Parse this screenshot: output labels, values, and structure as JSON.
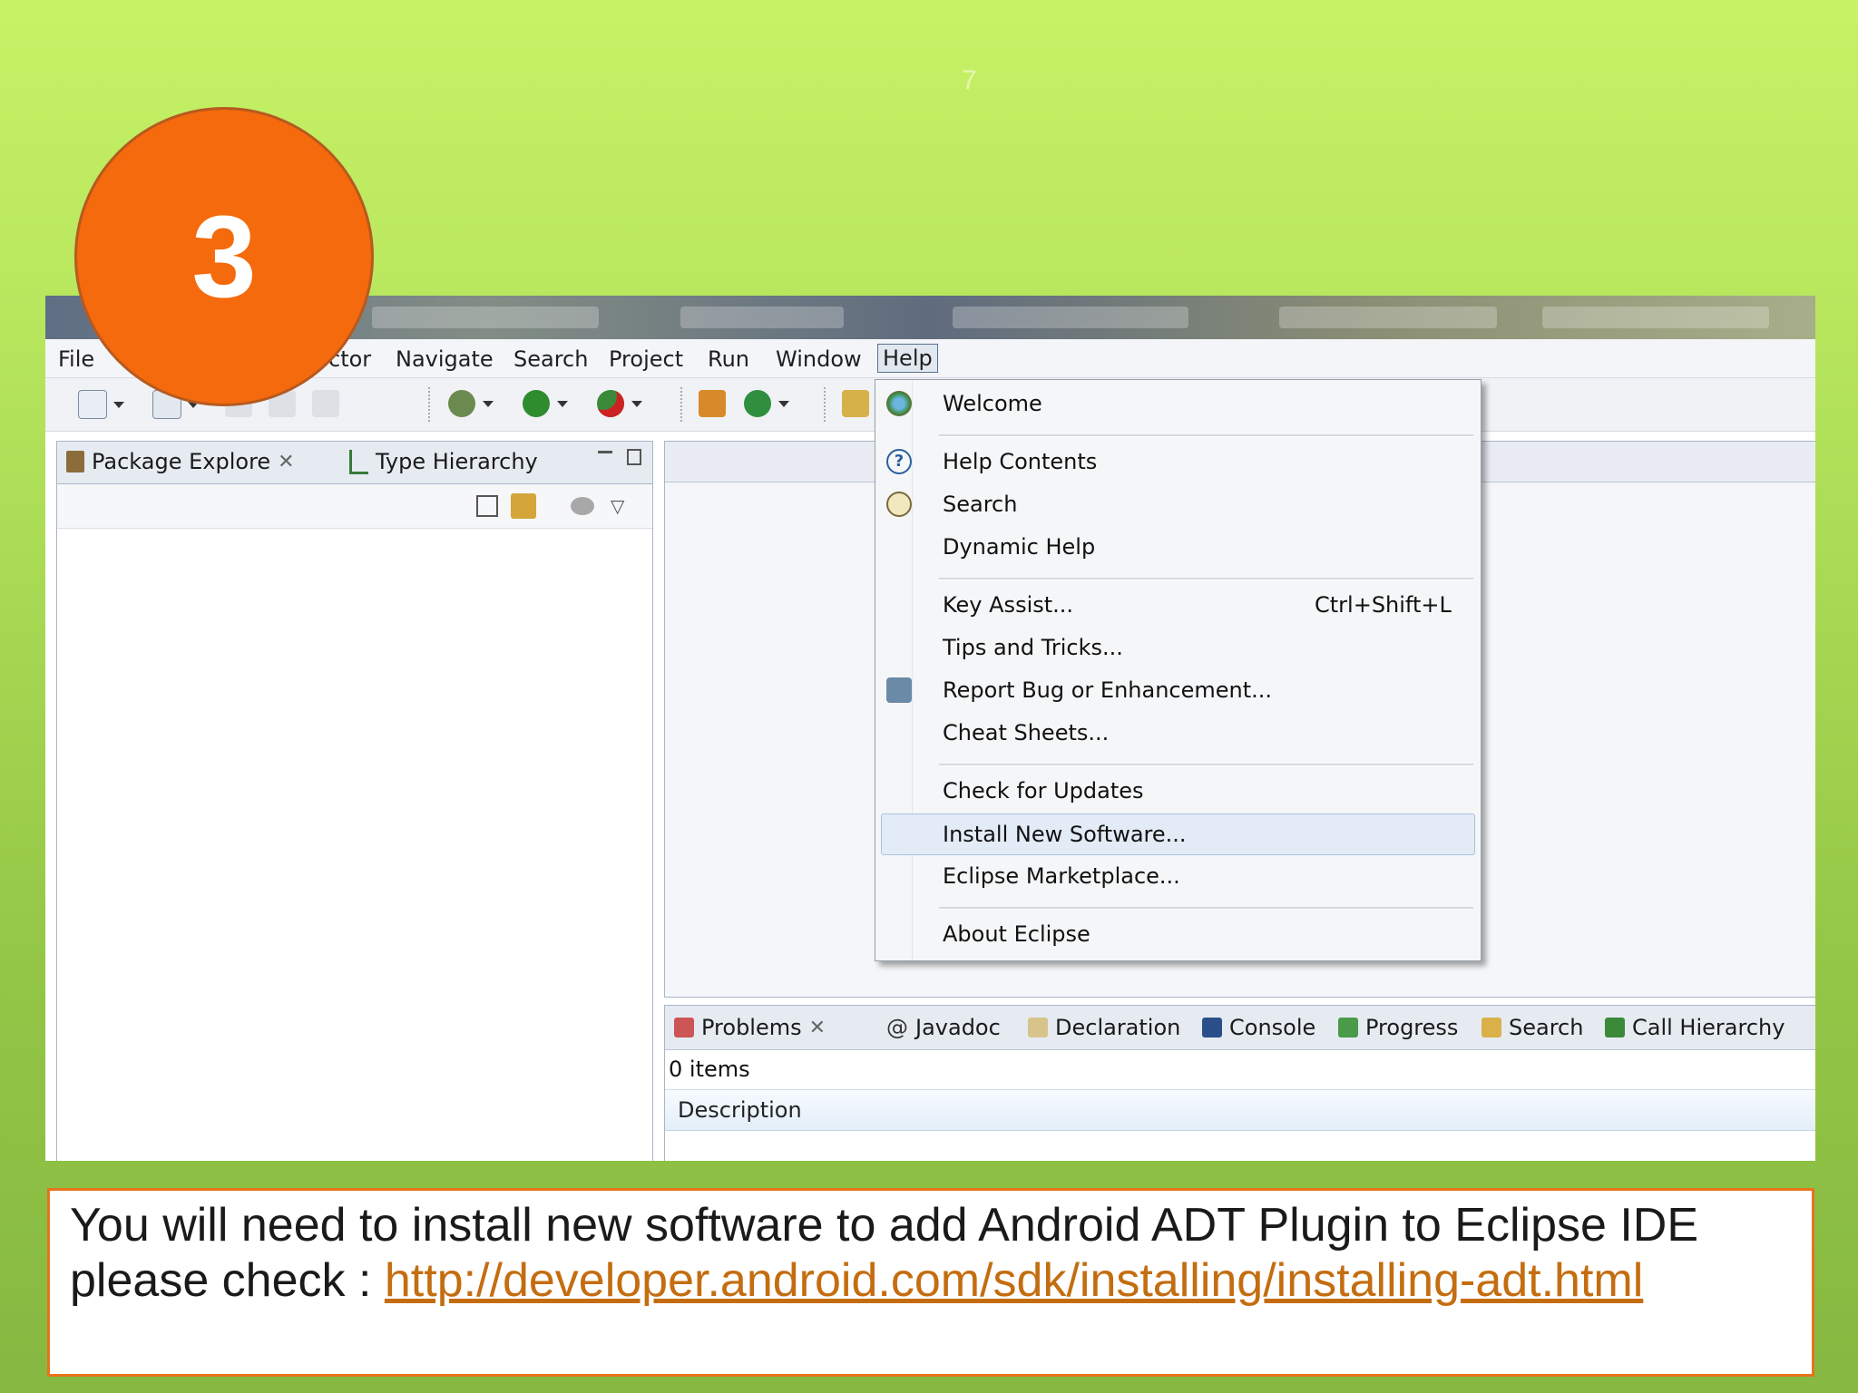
{
  "slide": {
    "number": "7",
    "step_badge": "3"
  },
  "menubar": {
    "items": [
      "File",
      "",
      "ctor",
      "Navigate",
      "Search",
      "Project",
      "Run",
      "Window",
      "Help"
    ]
  },
  "package_explorer": {
    "tabs": [
      {
        "label": "Package Explore",
        "icon": "package-icon"
      },
      {
        "label": "Type Hierarchy",
        "icon": "hierarchy-icon"
      }
    ]
  },
  "help_menu": {
    "items": [
      {
        "label": "Welcome",
        "icon": "welcome-icon"
      },
      {
        "label": "Help Contents",
        "icon": "help-icon"
      },
      {
        "label": "Search",
        "icon": "search-icon"
      },
      {
        "label": "Dynamic Help"
      },
      {
        "label": "Key Assist...",
        "shortcut": "Ctrl+Shift+L"
      },
      {
        "label": "Tips and Tricks..."
      },
      {
        "label": "Report Bug or Enhancement...",
        "icon": "bug-icon"
      },
      {
        "label": "Cheat Sheets..."
      },
      {
        "label": "Check for Updates"
      },
      {
        "label": "Install New Software...",
        "highlighted": true
      },
      {
        "label": "Eclipse Marketplace..."
      },
      {
        "label": "About Eclipse"
      }
    ]
  },
  "bottom_panel": {
    "tabs": [
      "Problems",
      "Javadoc",
      "Declaration",
      "Console",
      "Progress",
      "Search",
      "Call Hierarchy"
    ],
    "items_count": "0 items",
    "column_header": "Description"
  },
  "caption": {
    "text": "You will need to install new software to add Android ADT Plugin to Eclipse IDE please check : ",
    "link": "http://developer.android.com/sdk/installing/installing-adt.html"
  },
  "colors": {
    "badge": "#f56a0c",
    "caption_border": "#e8731b",
    "link": "#c46d10",
    "background": "#b2e25a"
  }
}
